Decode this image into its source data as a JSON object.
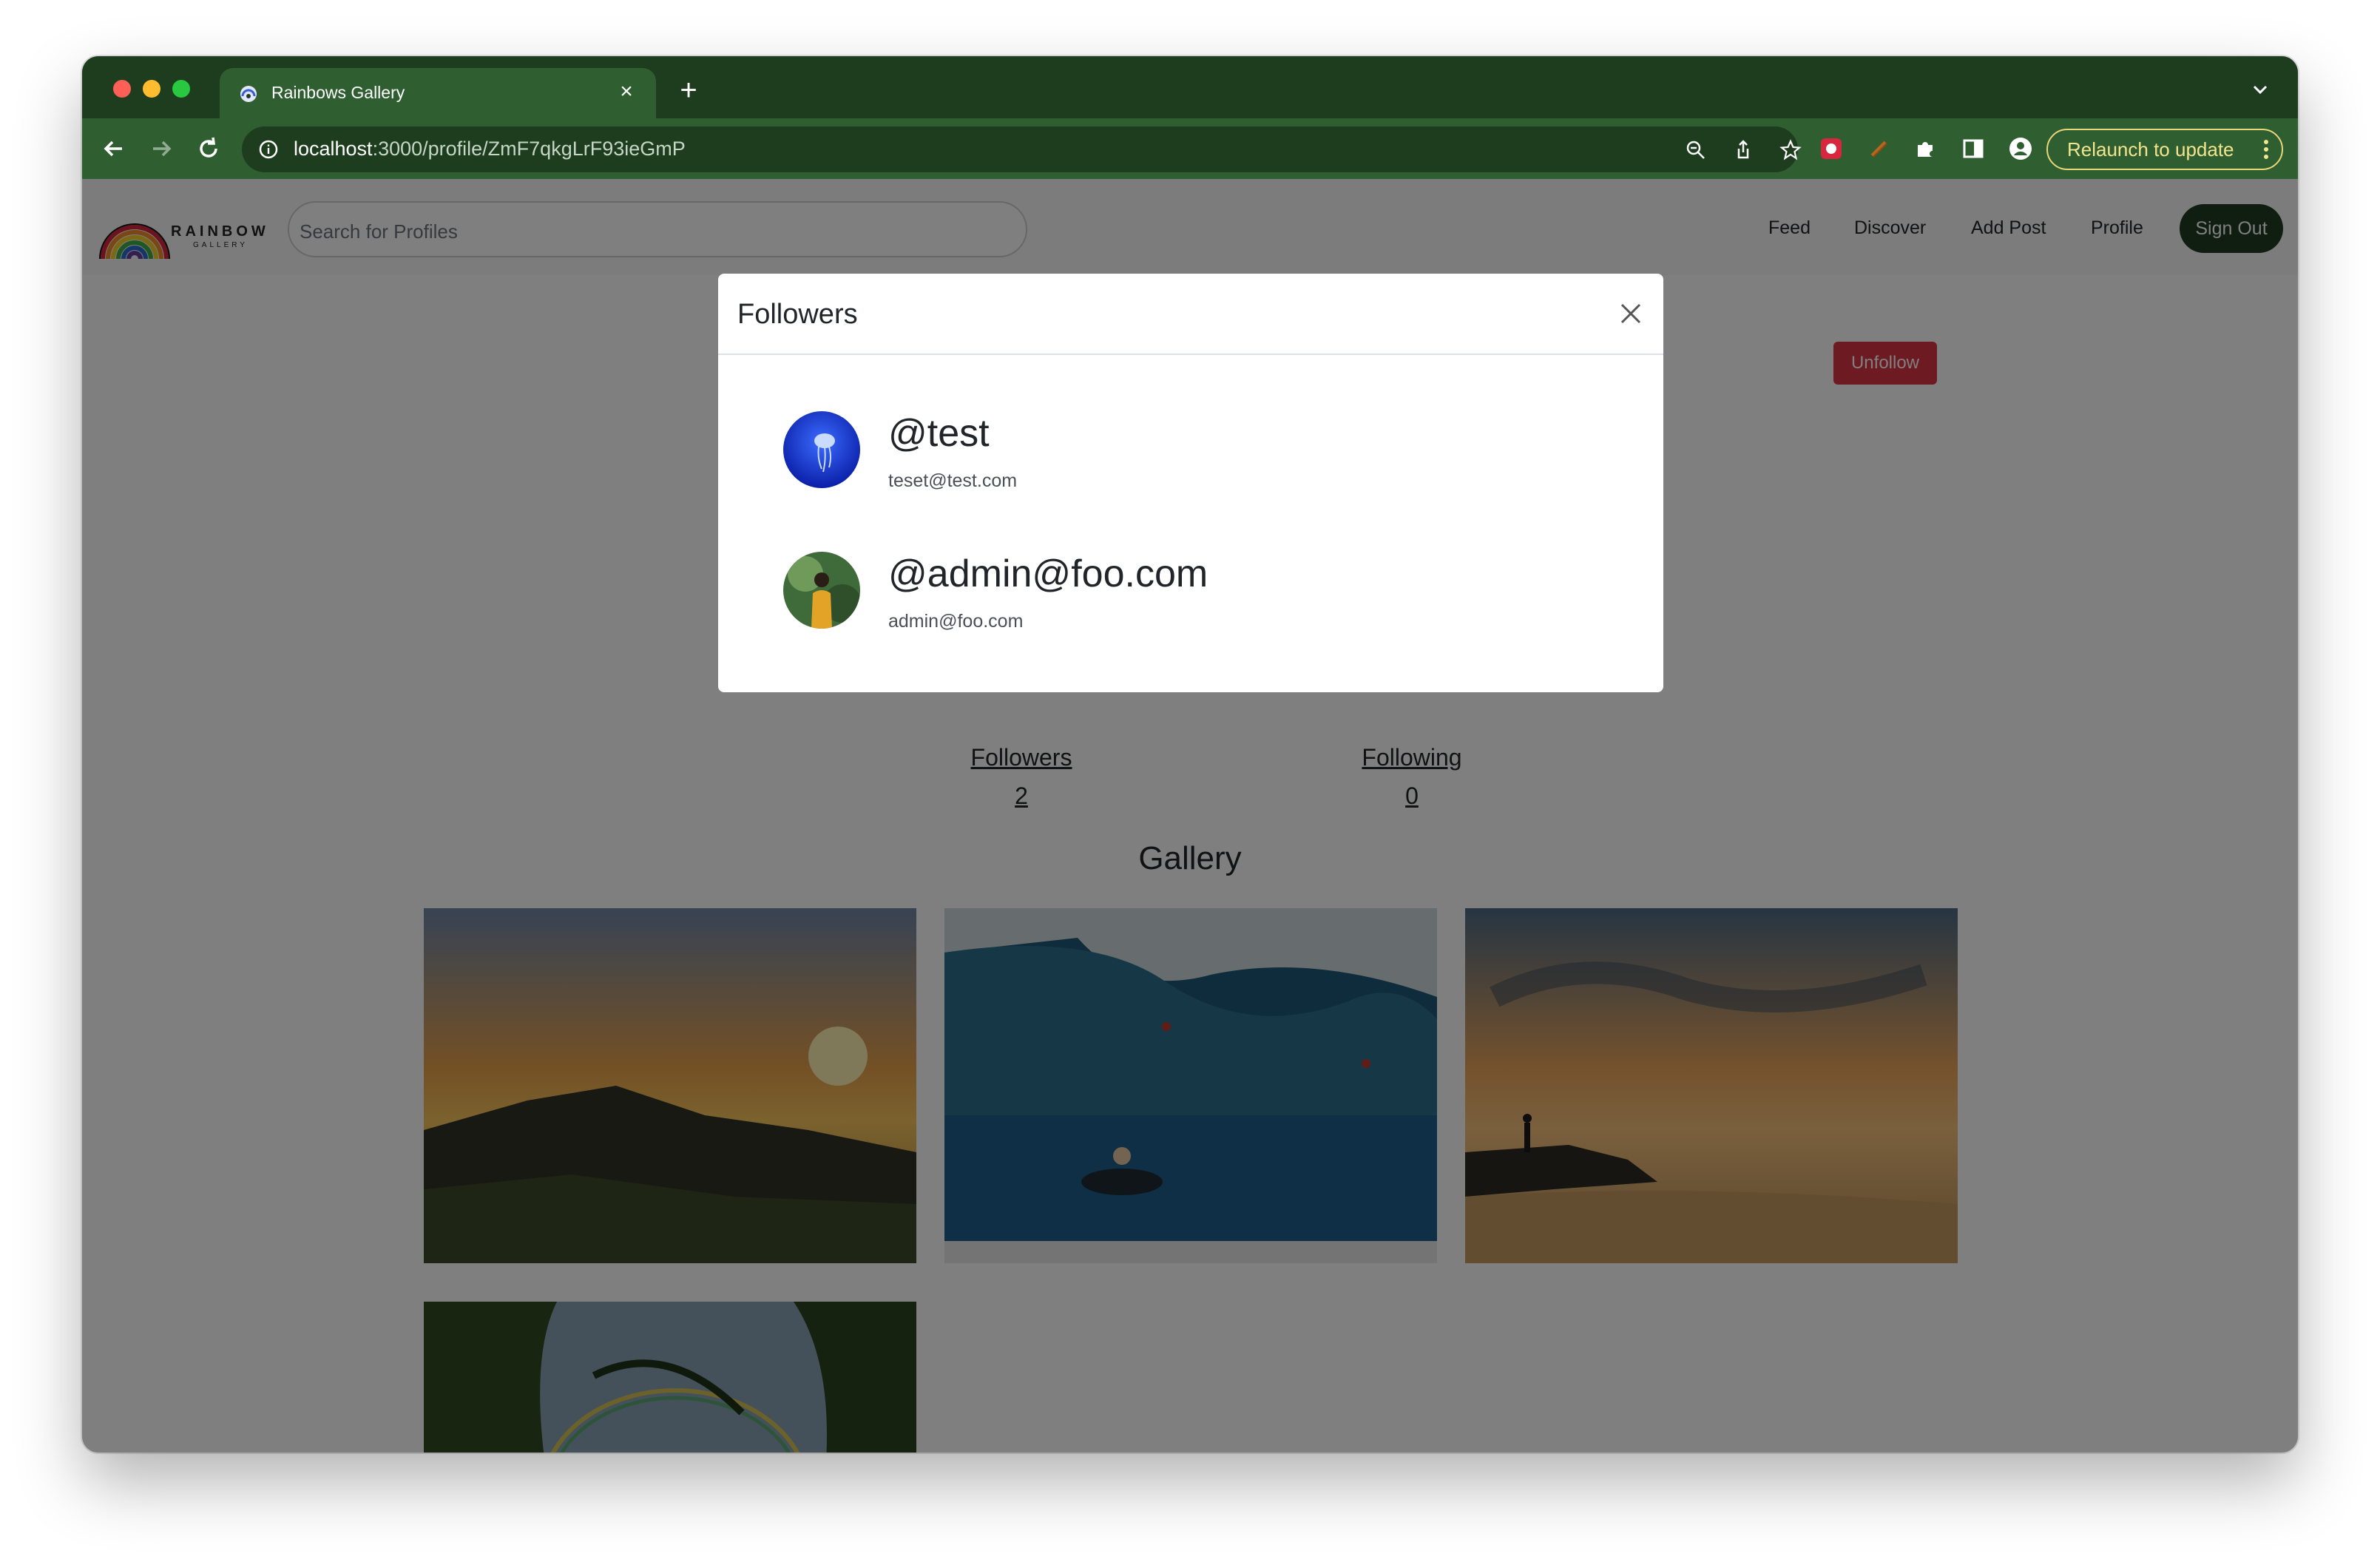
{
  "browser": {
    "tab_title": "Rainbows Gallery",
    "url_host": "localhost",
    "url_path": ":3000/profile/ZmF7qkgLrF93ieGmP",
    "relaunch_label": "Relaunch to update"
  },
  "navbar": {
    "logo_text": "RAINBOW",
    "logo_sub": "GALLERY",
    "search_placeholder": "Search for Profiles",
    "links": [
      "Feed",
      "Discover",
      "Add Post",
      "Profile"
    ],
    "signout_label": "Sign Out"
  },
  "profile": {
    "unfollow_label": "Unfollow",
    "followers_label": "Followers",
    "followers_count": "2",
    "following_label": "Following",
    "following_count": "0",
    "gallery_title": "Gallery"
  },
  "modal": {
    "title": "Followers",
    "followers": [
      {
        "handle": "@test",
        "email": "teset@test.com",
        "avatar": "jellyfish-avatar"
      },
      {
        "handle": "@admin@foo.com",
        "email": "admin@foo.com",
        "avatar": "person-avatar"
      }
    ]
  },
  "colors": {
    "browser_frame": "#1e3d1f",
    "toolbar": "#2f5e30",
    "danger": "#dc3545",
    "signout_bg": "#1f3d20"
  }
}
